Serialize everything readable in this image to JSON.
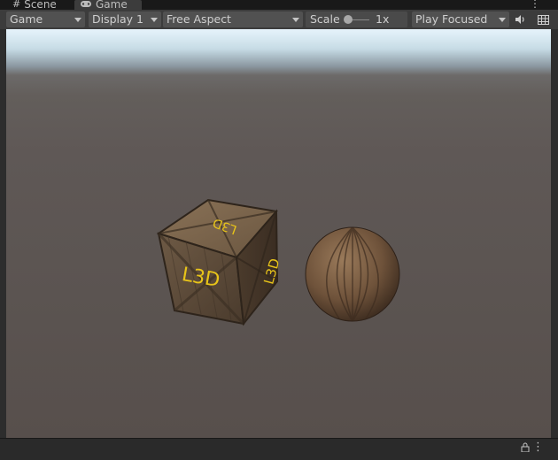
{
  "tabs": [
    {
      "label": "Scene",
      "icon": "grid-icon"
    },
    {
      "label": "Game",
      "icon": "gamepad-icon",
      "active": true
    }
  ],
  "toolbar": {
    "game_view_label": "Game",
    "display_label": "Display 1",
    "aspect_label": "Free Aspect",
    "scale_label": "Scale",
    "scale_value_label": "1x",
    "scale_value": 1,
    "play_mode_label": "Play Focused",
    "audio_icon": "speaker-icon",
    "stats_icon": "grid-icon"
  },
  "scene": {
    "crate_text_front": "L3D",
    "crate_text_top": "L3D",
    "crate_text_side": "L3D"
  },
  "colors": {
    "panel": "#3c3c3c",
    "dropdown": "#515151",
    "background": "#191919",
    "label_yellow": "#e8c419"
  }
}
